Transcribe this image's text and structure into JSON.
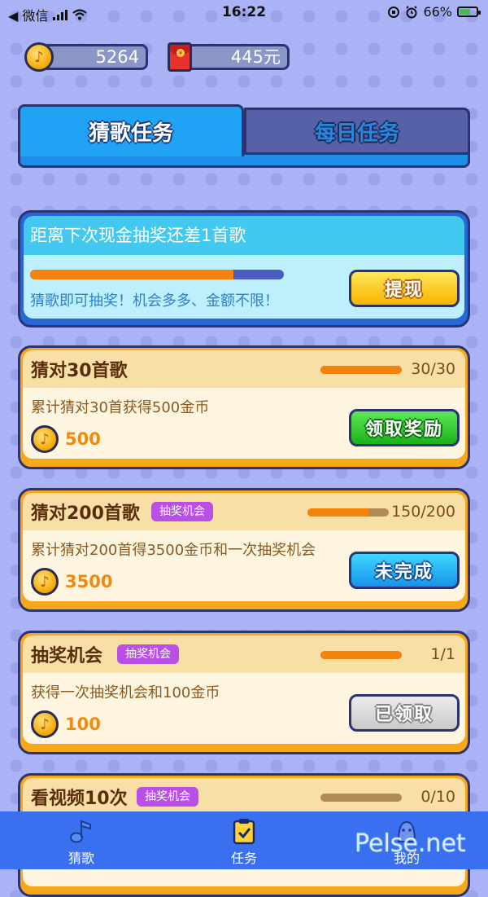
{
  "status_bar": {
    "back_label": "◀ 微信",
    "time": "16:22",
    "battery": "66%"
  },
  "wallet": {
    "coins": "5264",
    "cash": "445元",
    "coin_icon": "music-note-coin-icon",
    "cash_icon": "red-envelope-icon"
  },
  "tabs": [
    {
      "label": "猜歌任务",
      "active": true
    },
    {
      "label": "每日任务",
      "active": false
    }
  ],
  "lottery": {
    "header": "距离下次现金抽奖还差1首歌",
    "progress": 0.8,
    "subtitle": "猜歌即可抽奖！机会多多、金额不限！",
    "button": "提现"
  },
  "tasks": [
    {
      "title": "猜对30首歌",
      "tag": "",
      "progress_text": "30/30",
      "progress": 1.0,
      "desc": "累计猜对30首获得500金币",
      "reward": "500",
      "button": "领取奖励",
      "state": "claimable"
    },
    {
      "title": "猜对200首歌",
      "tag": "抽奖机会",
      "progress_text": "150/200",
      "progress": 0.75,
      "desc": "累计猜对200首得3500金币和一次抽奖机会",
      "reward": "3500",
      "button": "未完成",
      "state": "incomplete"
    },
    {
      "title": "抽奖机会",
      "tag": "抽奖机会",
      "progress_text": "1/1",
      "progress": 1.0,
      "desc": "获得一次抽奖机会和100金币",
      "reward": "100",
      "button": "已领取",
      "state": "claimed"
    },
    {
      "title": "看视频10次",
      "tag": "抽奖机会",
      "progress_text": "0/10",
      "progress": 0.0,
      "desc": "",
      "reward": "",
      "button": "",
      "state": "partial"
    }
  ],
  "nav": [
    {
      "label": "猜歌",
      "icon": "music-note-icon"
    },
    {
      "label": "任务",
      "icon": "task-clipboard-icon"
    },
    {
      "label": "我的",
      "icon": "profile-icon"
    }
  ],
  "watermark": "Pelse.net"
}
